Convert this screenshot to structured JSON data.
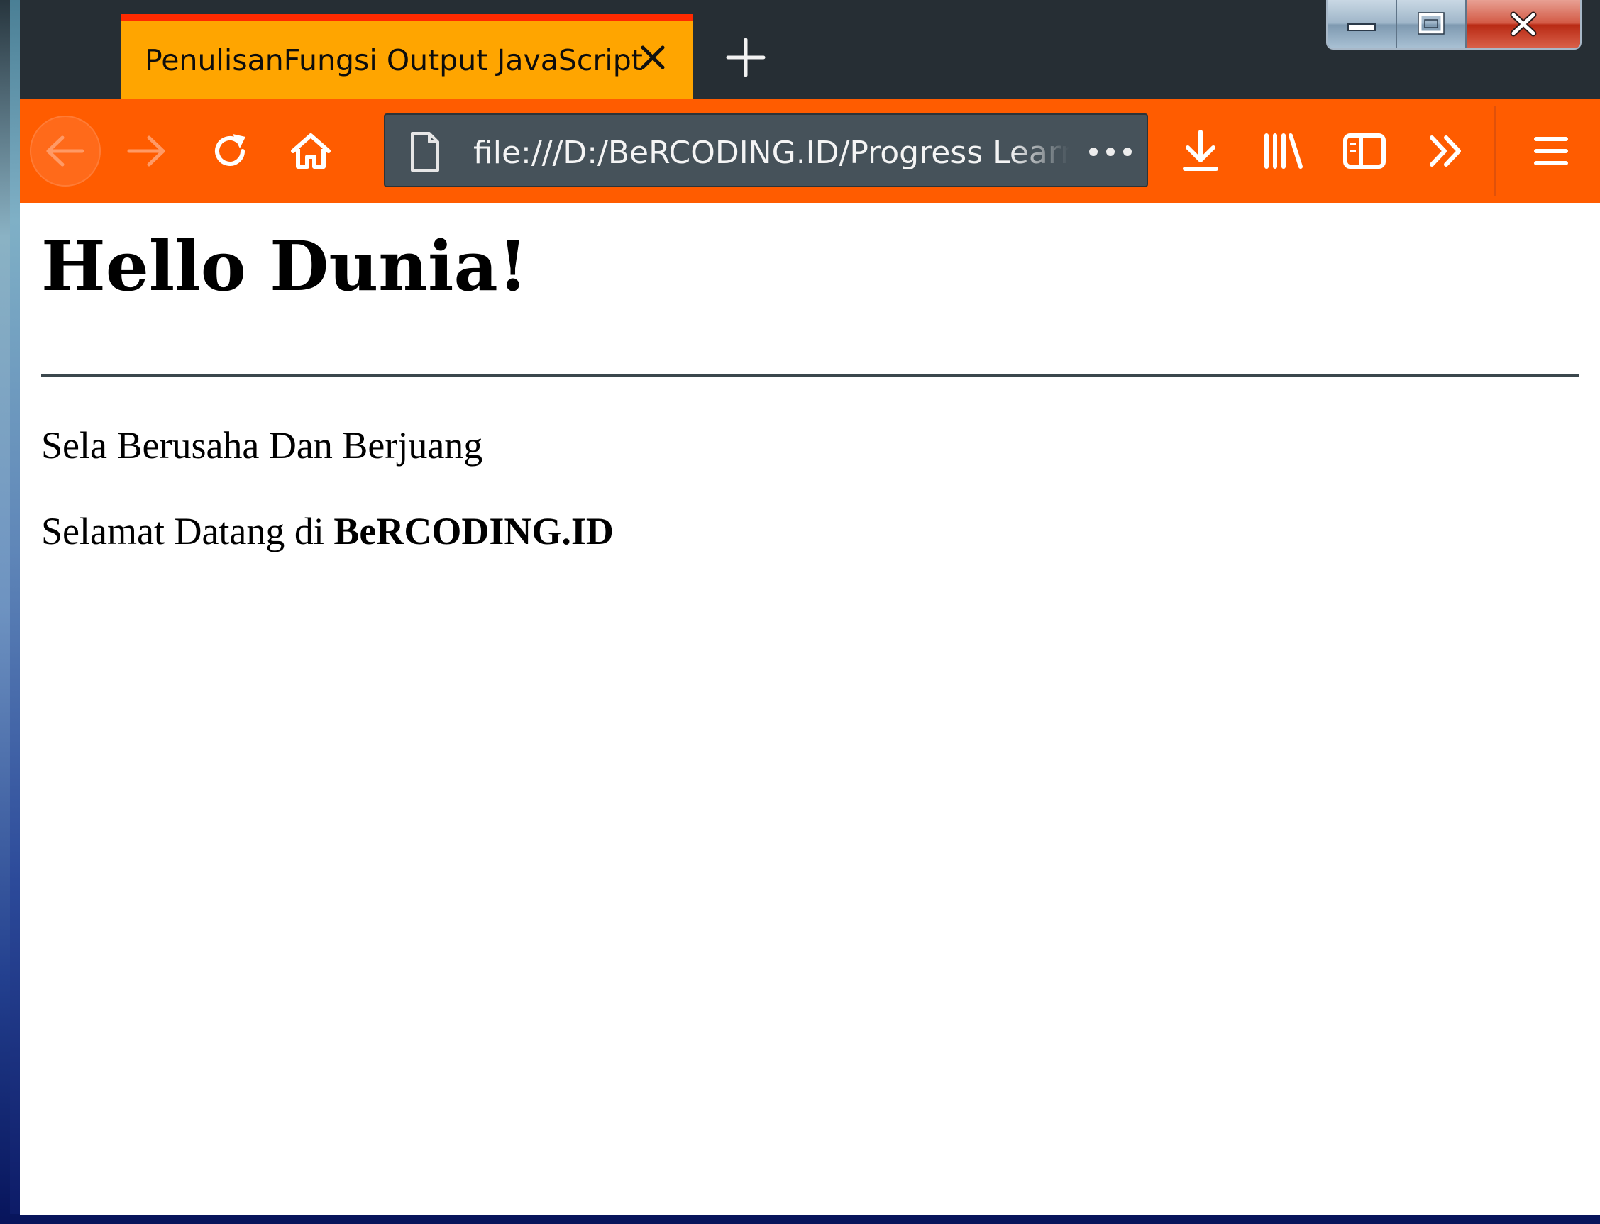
{
  "window": {
    "controls": {
      "minimize": "minimize",
      "maximize": "maximize",
      "close": "close"
    }
  },
  "tabs": [
    {
      "title": "PenulisanFungsi Output JavaScript",
      "active": true,
      "accent_color": "#ff2a00",
      "background_color": "#ffa500"
    }
  ],
  "toolbar": {
    "background_color": "#ff5c00",
    "url": "file:///D:/BeRCODING.ID/Progress Learning",
    "icons": [
      "back-arrow-icon",
      "forward-arrow-icon",
      "reload-icon",
      "home-icon",
      "page-icon",
      "page-actions-icon",
      "download-icon",
      "library-icon",
      "sidebar-icon",
      "overflow-chevron-icon",
      "hamburger-menu-icon"
    ]
  },
  "page": {
    "heading": "Hello Dunia!",
    "paragraph1": "Sela Berusaha Dan Berjuang",
    "paragraph2_prefix": "Selamat Datang di ",
    "paragraph2_bold": "BeRCODING.ID"
  }
}
